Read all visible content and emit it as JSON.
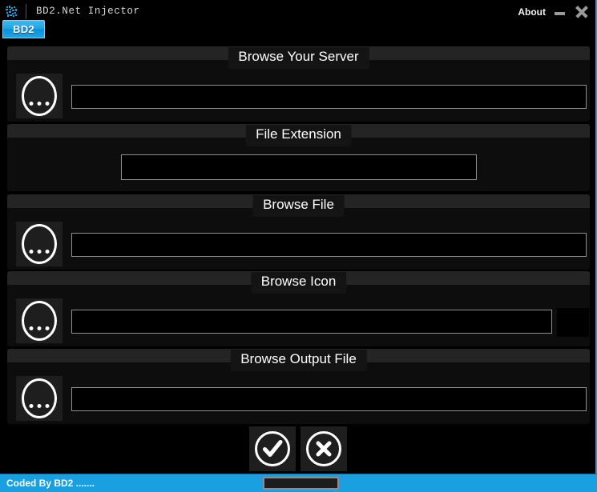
{
  "window": {
    "title": "BD2.Net Injector",
    "icon_name": "app-logo-icon",
    "accent_color": "#1a9fe0",
    "background_color": "#000000",
    "panel_color": "#0d0d0d",
    "header_color": "#242424"
  },
  "titlebar": {
    "about_label": "About",
    "minimize_label": "minimize-icon",
    "close_label": "close-icon"
  },
  "tabs": [
    {
      "label": "BD2",
      "selected": true
    }
  ],
  "panels": [
    {
      "id": "browse-your-server",
      "title": "Browse Your Server",
      "browse_button_label": "...",
      "input_value": "",
      "input_placeholder": ""
    },
    {
      "id": "file-extension",
      "title": "File Extension",
      "input_value": "",
      "input_placeholder": ""
    },
    {
      "id": "browse-file",
      "title": "Browse File",
      "browse_button_label": "...",
      "input_value": "",
      "input_placeholder": ""
    },
    {
      "id": "browse-icon",
      "title": "Browse Icon",
      "browse_button_label": "...",
      "input_value": "",
      "input_placeholder": "",
      "has_icon_preview": true
    },
    {
      "id": "browse-output-file",
      "title": "Browse Output File",
      "browse_button_label": "...",
      "input_value": "",
      "input_placeholder": ""
    }
  ],
  "actions": {
    "accept_label": "accept-check-icon",
    "cancel_label": "cancel-x-icon"
  },
  "statusbar": {
    "text": "Coded By BD2 .......",
    "progress_percent": 0
  }
}
